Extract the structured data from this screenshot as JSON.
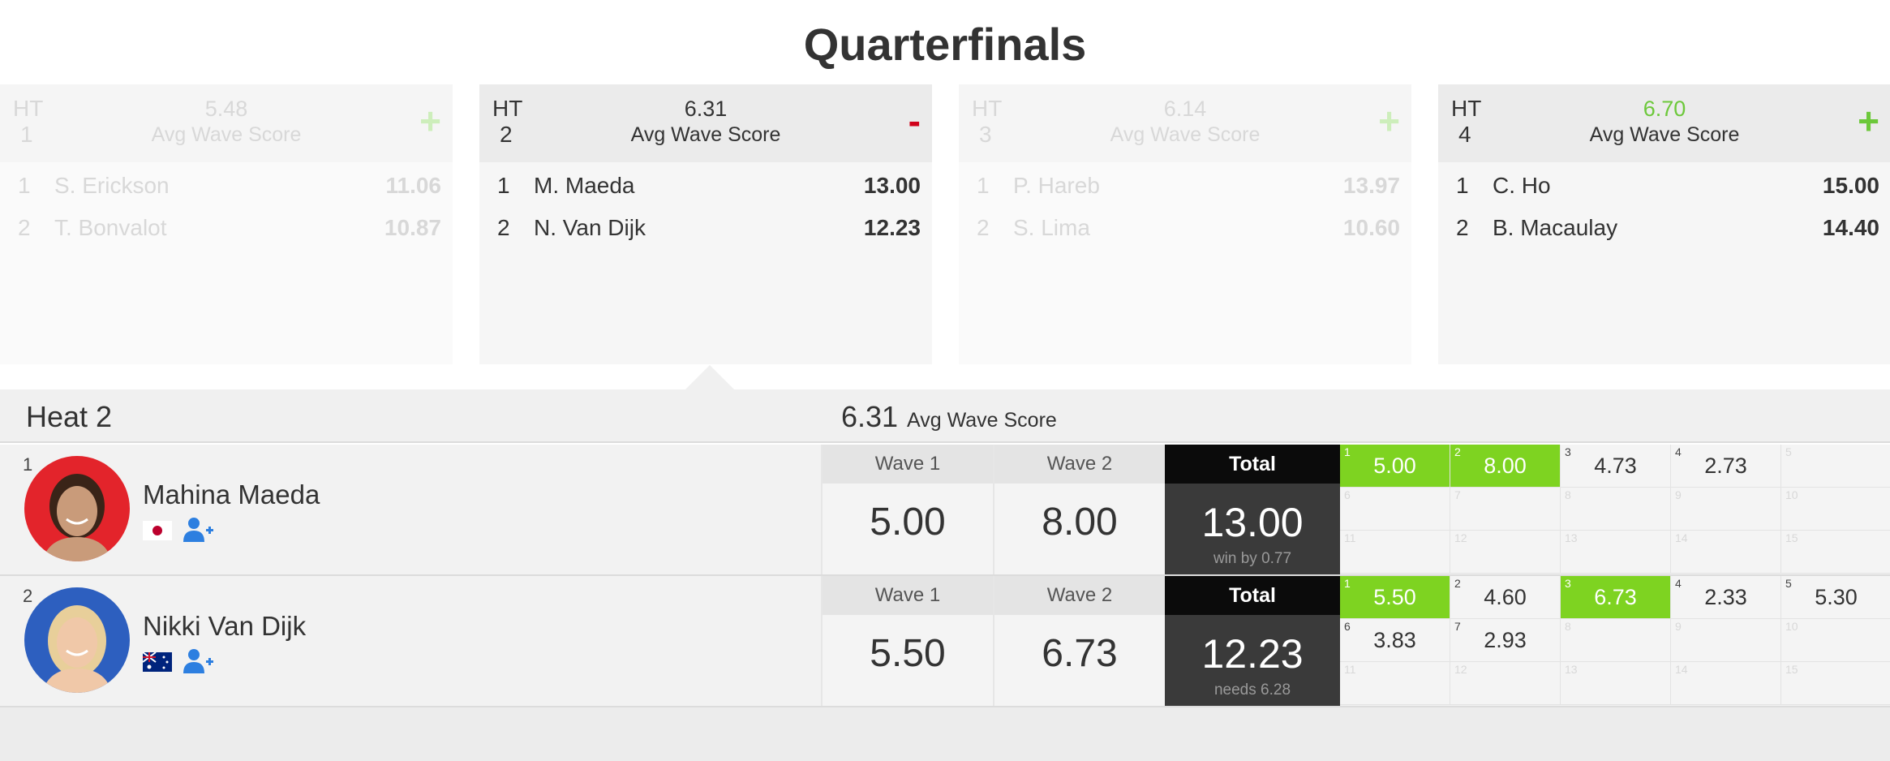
{
  "page": {
    "title": "Quarterfinals"
  },
  "cards": [
    {
      "ht_label": "HT",
      "ht_num": "1",
      "avg": "5.48",
      "avg_label": "Avg Wave Score",
      "toggle": "+",
      "rows": [
        {
          "rank": "1",
          "name": "S. Erickson",
          "score": "11.06"
        },
        {
          "rank": "2",
          "name": "T. Bonvalot",
          "score": "10.87"
        }
      ]
    },
    {
      "ht_label": "HT",
      "ht_num": "2",
      "avg": "6.31",
      "avg_label": "Avg Wave Score",
      "toggle": "-",
      "rows": [
        {
          "rank": "1",
          "name": "M. Maeda",
          "score": "13.00"
        },
        {
          "rank": "2",
          "name": "N. Van Dijk",
          "score": "12.23"
        }
      ]
    },
    {
      "ht_label": "HT",
      "ht_num": "3",
      "avg": "6.14",
      "avg_label": "Avg Wave Score",
      "toggle": "+",
      "rows": [
        {
          "rank": "1",
          "name": "P. Hareb",
          "score": "13.97"
        },
        {
          "rank": "2",
          "name": "S. Lima",
          "score": "10.60"
        }
      ]
    },
    {
      "ht_label": "HT",
      "ht_num": "4",
      "avg": "6.70",
      "avg_label": "Avg Wave Score",
      "toggle": "+",
      "rows": [
        {
          "rank": "1",
          "name": "C. Ho",
          "score": "15.00"
        },
        {
          "rank": "2",
          "name": "B. Macaulay",
          "score": "14.40"
        }
      ]
    }
  ],
  "heat": {
    "title": "Heat 2",
    "avg": "6.31",
    "avg_label": "Avg Wave Score",
    "athletes": [
      {
        "rank": "1",
        "name": "Mahina Maeda",
        "country_flag": "japan-flag",
        "wave1_label": "Wave 1",
        "wave2_label": "Wave 2",
        "wave1": "5.00",
        "wave2": "8.00",
        "total_label": "Total",
        "total": "13.00",
        "status": "win by 0.77",
        "waves": [
          {
            "n": "1",
            "score": "5.00",
            "counted": true
          },
          {
            "n": "2",
            "score": "8.00",
            "counted": true
          },
          {
            "n": "3",
            "score": "4.73",
            "counted": false
          },
          {
            "n": "4",
            "score": "2.73",
            "counted": false
          },
          {
            "n": "5",
            "score": "",
            "counted": false
          },
          {
            "n": "6",
            "score": "",
            "counted": false
          },
          {
            "n": "7",
            "score": "",
            "counted": false
          },
          {
            "n": "8",
            "score": "",
            "counted": false
          },
          {
            "n": "9",
            "score": "",
            "counted": false
          },
          {
            "n": "10",
            "score": "",
            "counted": false
          },
          {
            "n": "11",
            "score": "",
            "counted": false
          },
          {
            "n": "12",
            "score": "",
            "counted": false
          },
          {
            "n": "13",
            "score": "",
            "counted": false
          },
          {
            "n": "14",
            "score": "",
            "counted": false
          },
          {
            "n": "15",
            "score": "",
            "counted": false
          }
        ]
      },
      {
        "rank": "2",
        "name": "Nikki Van Dijk",
        "country_flag": "australia-flag",
        "wave1_label": "Wave 1",
        "wave2_label": "Wave 2",
        "wave1": "5.50",
        "wave2": "6.73",
        "total_label": "Total",
        "total": "12.23",
        "status": "needs 6.28",
        "waves": [
          {
            "n": "1",
            "score": "5.50",
            "counted": true
          },
          {
            "n": "2",
            "score": "4.60",
            "counted": false
          },
          {
            "n": "3",
            "score": "6.73",
            "counted": true
          },
          {
            "n": "4",
            "score": "2.33",
            "counted": false
          },
          {
            "n": "5",
            "score": "5.30",
            "counted": false
          },
          {
            "n": "6",
            "score": "3.83",
            "counted": false
          },
          {
            "n": "7",
            "score": "2.93",
            "counted": false
          },
          {
            "n": "8",
            "score": "",
            "counted": false
          },
          {
            "n": "9",
            "score": "",
            "counted": false
          },
          {
            "n": "10",
            "score": "",
            "counted": false
          },
          {
            "n": "11",
            "score": "",
            "counted": false
          },
          {
            "n": "12",
            "score": "",
            "counted": false
          },
          {
            "n": "13",
            "score": "",
            "counted": false
          },
          {
            "n": "14",
            "score": "",
            "counted": false
          },
          {
            "n": "15",
            "score": "",
            "counted": false
          }
        ]
      }
    ]
  },
  "colors": {
    "counted_wave": "#7ed321",
    "minus": "#d0021b",
    "plus": "#6cc83a",
    "avatar1_bg": "#e3242b",
    "avatar2_bg": "#2d5fbf"
  }
}
